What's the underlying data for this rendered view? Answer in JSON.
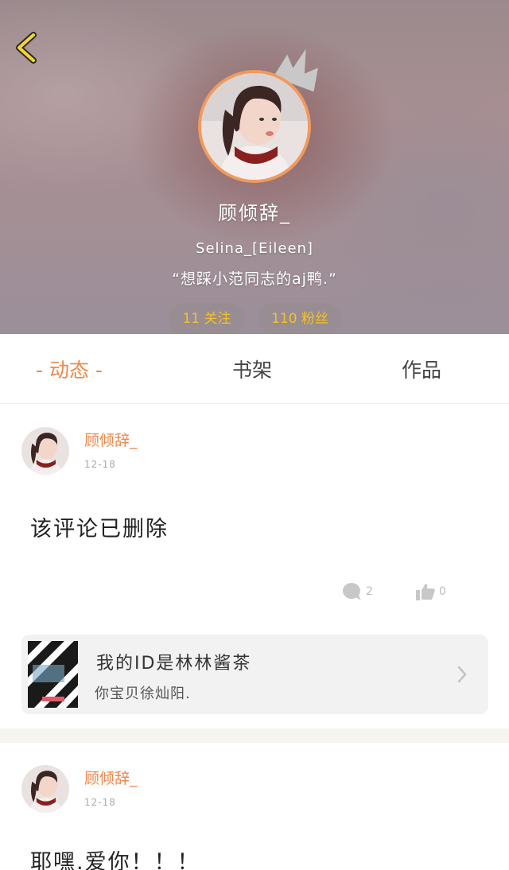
{
  "profile": {
    "username": "顾倾辞_",
    "subname": "Selina_[Eileen]",
    "signature": "“想踩小范同志的aj鸭.”",
    "follow_label": "11 关注",
    "fans_label": "110 粉丝"
  },
  "tabs": [
    {
      "label": "- 动态 -"
    },
    {
      "label": "书架"
    },
    {
      "label": "作品"
    }
  ],
  "posts": [
    {
      "author": "顾倾辞_",
      "date": "12-18",
      "text": "该评论已删除",
      "comment_count": "2",
      "like_count": "0",
      "card": {
        "title": "我的ID是林林酱茶",
        "subtitle": "你宝贝徐灿阳."
      }
    },
    {
      "author": "顾倾辞_",
      "date": "12-18",
      "text": "耶嘿.爱你！！！"
    }
  ],
  "colors": {
    "accent": "#f0874a",
    "follow_text": "#f3c12a",
    "avatar_border": "#f09a5e"
  },
  "icons": [
    "back-arrow-icon",
    "crown-icon",
    "comment-icon",
    "thumbs-up-icon",
    "chevron-right-icon"
  ]
}
